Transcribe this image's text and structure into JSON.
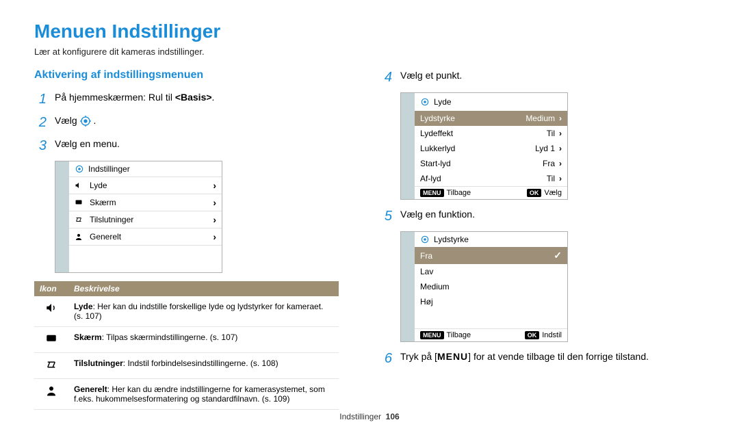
{
  "page": {
    "title": "Menuen Indstillinger",
    "subtitle": "Lær at konfigurere dit kameras indstillinger.",
    "section_head": "Aktivering af indstillingsmenuen",
    "footer_section": "Indstillinger",
    "footer_page": "106"
  },
  "steps_left": {
    "s1_num": "1",
    "s1_pre": "På hjemmeskærmen: Rul til ",
    "s1_bold": "<Basis>",
    "s1_post": ".",
    "s2_num": "2",
    "s2_pre": "Vælg ",
    "s2_post": ".",
    "s3_num": "3",
    "s3_text": "Vælg en menu."
  },
  "steps_right": {
    "s4_num": "4",
    "s4_text": "Vælg et punkt.",
    "s5_num": "5",
    "s5_text": "Vælg en funktion.",
    "s6_num": "6",
    "s6_pre": "Tryk på [",
    "s6_key": "MENU",
    "s6_post": "] for at vende tilbage til den forrige tilstand."
  },
  "screen3": {
    "title": "Indstillinger",
    "items": [
      {
        "label": "Lyde"
      },
      {
        "label": "Skærm"
      },
      {
        "label": "Tilslutninger"
      },
      {
        "label": "Generelt"
      }
    ]
  },
  "screen4": {
    "title": "Lyde",
    "rows": [
      {
        "label": "Lydstyrke",
        "val": "Medium",
        "sel": true
      },
      {
        "label": "Lydeffekt",
        "val": "Til",
        "sel": false
      },
      {
        "label": "Lukkerlyd",
        "val": "Lyd 1",
        "sel": false
      },
      {
        "label": "Start-lyd",
        "val": "Fra",
        "sel": false
      },
      {
        "label": "Af-lyd",
        "val": "Til",
        "sel": false
      }
    ],
    "footer": {
      "menu_tag": "MENU",
      "back": "Tilbage",
      "ok_tag": "OK",
      "select": "Vælg"
    }
  },
  "screen5": {
    "title": "Lydstyrke",
    "rows": [
      {
        "label": "Fra",
        "sel": true,
        "check": true
      },
      {
        "label": "Lav",
        "sel": false
      },
      {
        "label": "Medium",
        "sel": false
      },
      {
        "label": "Høj",
        "sel": false
      }
    ],
    "footer": {
      "menu_tag": "MENU",
      "back": "Tilbage",
      "ok_tag": "OK",
      "select": "Indstil"
    }
  },
  "table": {
    "h1": "Ikon",
    "h2": "Beskrivelse",
    "rows": [
      {
        "name": "Lyde",
        "desc": ": Her kan du indstille forskellige lyde og lydstyrker for kameraet. (s. 107)"
      },
      {
        "name": "Skærm",
        "desc": ": Tilpas skærmindstillingerne. (s. 107)"
      },
      {
        "name": "Tilslutninger",
        "desc": ": Indstil forbindelsesindstillingerne. (s. 108)"
      },
      {
        "name": "Generelt",
        "desc": ": Her kan du ændre indstillingerne for kamerasystemet, som f.eks. hukommelsesformatering og standardfilnavn. (s. 109)"
      }
    ]
  }
}
